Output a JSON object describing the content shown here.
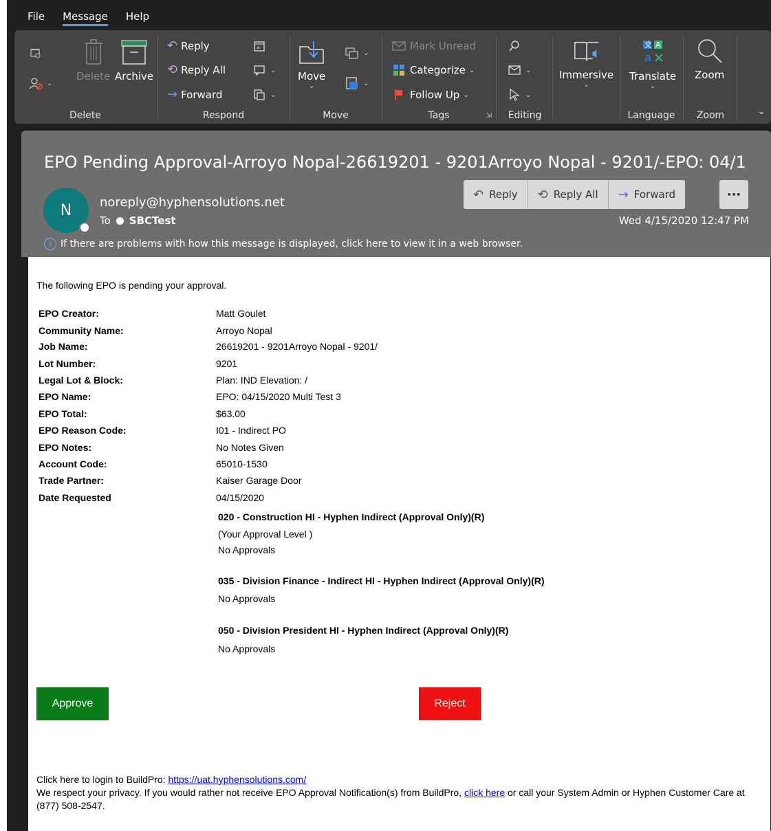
{
  "menu": {
    "items": [
      "File",
      "Message",
      "Help"
    ],
    "active": "Message"
  },
  "ribbon": {
    "delete_group": {
      "delete": "Delete",
      "archive": "Archive",
      "label": "Delete"
    },
    "respond_group": {
      "reply": "Reply",
      "reply_all": "Reply All",
      "forward": "Forward",
      "label": "Respond"
    },
    "move_group": {
      "move": "Move",
      "label": "Move"
    },
    "tags_group": {
      "mark_unread": "Mark Unread",
      "categorize": "Categorize",
      "follow_up": "Follow Up",
      "label": "Tags"
    },
    "editing_group": {
      "label": "Editing"
    },
    "immersive_group": {
      "immersive": "Immersive"
    },
    "language_group": {
      "translate": "Translate",
      "label": "Language"
    },
    "zoom_group": {
      "zoom": "Zoom",
      "label": "Zoom"
    }
  },
  "message": {
    "subject": "EPO Pending Approval-Arroyo Nopal-26619201 - 9201Arroyo Nopal - 9201/-EPO: 04/1...",
    "avatar_initial": "N",
    "sender": "noreply@hyphensolutions.net",
    "to_label": "To",
    "recipient": "SBCTest",
    "date": "Wed 4/15/2020 12:47 PM",
    "info": "If there are problems with how this message is displayed, click here to view it in a web browser.",
    "actions": {
      "reply": "Reply",
      "reply_all": "Reply All",
      "forward": "Forward",
      "more": "···"
    }
  },
  "body": {
    "intro": "The following EPO is pending your approval.",
    "fields": [
      {
        "label": "EPO Creator:",
        "value": "Matt Goulet"
      },
      {
        "label": "Community Name:",
        "value": "Arroyo Nopal"
      },
      {
        "label": "Job Name:",
        "value": "26619201 - 9201Arroyo Nopal - 9201/"
      },
      {
        "label": "Lot Number:",
        "value": "9201"
      },
      {
        "label": "Legal Lot & Block:",
        "value": "Plan: IND Elevation: /"
      },
      {
        "label": "EPO Name:",
        "value": "EPO: 04/15/2020 Multi Test 3"
      },
      {
        "label": "EPO Total:",
        "value": "$63.00"
      },
      {
        "label": "EPO Reason Code:",
        "value": "I01 - Indirect PO"
      },
      {
        "label": "EPO Notes:",
        "value": "No Notes Given"
      },
      {
        "label": "Account Code:",
        "value": "65010-1530"
      },
      {
        "label": "Trade Partner:",
        "value": "Kaiser Garage Door"
      },
      {
        "label": "Date Requested",
        "value": "04/15/2020"
      }
    ],
    "approvals": [
      {
        "title": "020 - Construction HI - Hyphen Indirect (Approval Only)(R)",
        "note": "(Your Approval Level )",
        "status": "No Approvals"
      },
      {
        "title": "035 - Division Finance - Indirect HI - Hyphen Indirect (Approval Only)(R)",
        "status": "No Approvals"
      },
      {
        "title": "050 - Division President HI - Hyphen Indirect (Approval Only)(R)",
        "status": "No Approvals"
      }
    ],
    "approve_label": "Approve",
    "reject_label": "Reject",
    "footer": {
      "login_text": "Click here to login to BuildPro: ",
      "login_link": "https://uat.hyphensolutions.com/",
      "privacy_text": "We respect your privacy. If you would rather not receive EPO Approval Notification(s) from BuildPro, ",
      "privacy_link": "click here",
      "privacy_tail": " or call your System Admin or Hyphen Customer Care at (877) 508-2547."
    }
  },
  "colors": {
    "approve": "#0a7d1a",
    "reject": "#ee1111",
    "avatar": "#0e7a7c",
    "ribbon": "#444444",
    "header": "#6e6e6e"
  }
}
